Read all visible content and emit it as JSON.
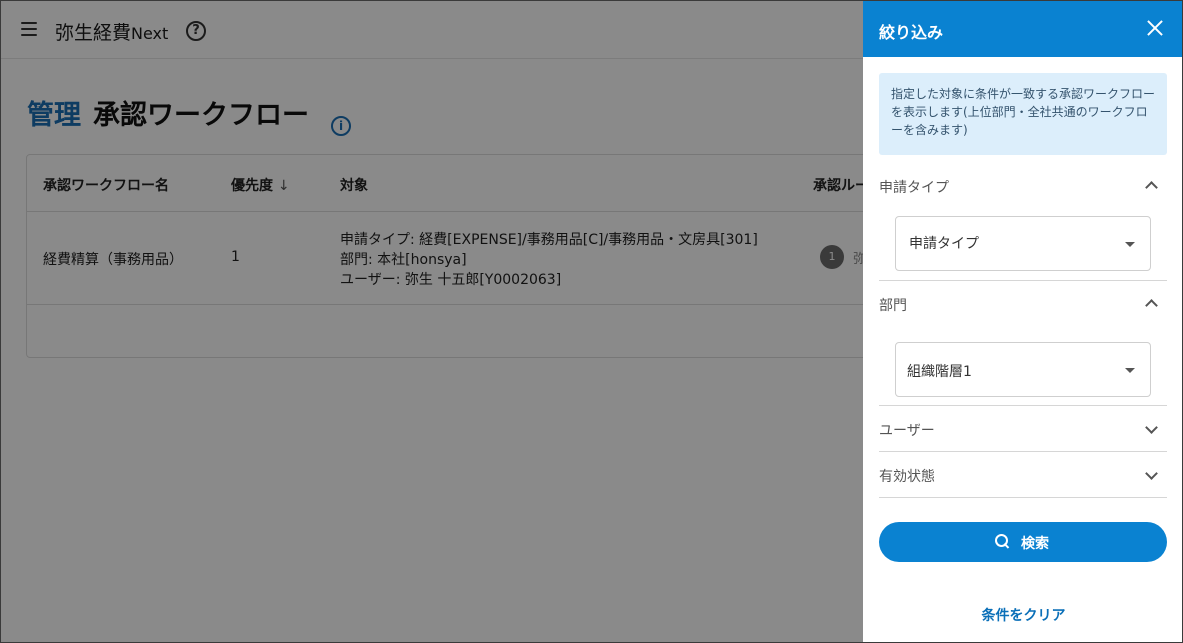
{
  "appbar": {
    "brand": "弥生経費",
    "brand_sub": "Next",
    "help_glyph": "?"
  },
  "page": {
    "breadcrumb": "管理",
    "title": "承認ワークフロー",
    "info_glyph": "i"
  },
  "table": {
    "headers": {
      "name": "承認ワークフロー名",
      "priority": "優先度",
      "priority_sort": "↓",
      "target": "対象",
      "route": "承認ルー"
    },
    "rows": [
      {
        "name": "経費精算（事務用品）",
        "priority": "1",
        "target_lines": [
          "申請タイプ: 経費[EXPENSE]/事務用品[C]/事務用品・文房具[301]",
          "部門: 本社[honsya]",
          "ユーザー: 弥生 十五郎[Y0002063]"
        ],
        "route_step": "1",
        "route_name": "弥"
      }
    ]
  },
  "filter_panel": {
    "title": "絞り込み",
    "notice": "指定した対象に条件が一致する承認ワークフローを表示します(上位部門・全社共通のワークフローを含みます)",
    "sections": {
      "request_type": {
        "label": "申請タイプ",
        "expanded": true,
        "select_value": "申請タイプ"
      },
      "department": {
        "label": "部門",
        "expanded": true,
        "select_value": "組織階層1"
      },
      "user": {
        "label": "ユーザー",
        "expanded": false
      },
      "status": {
        "label": "有効状態",
        "expanded": false
      }
    },
    "search_button": "検索",
    "clear_link": "条件をクリア"
  },
  "colors": {
    "primary": "#0a82d1",
    "breadcrumb": "#1a6fb5",
    "notice_bg": "#dceefb"
  }
}
